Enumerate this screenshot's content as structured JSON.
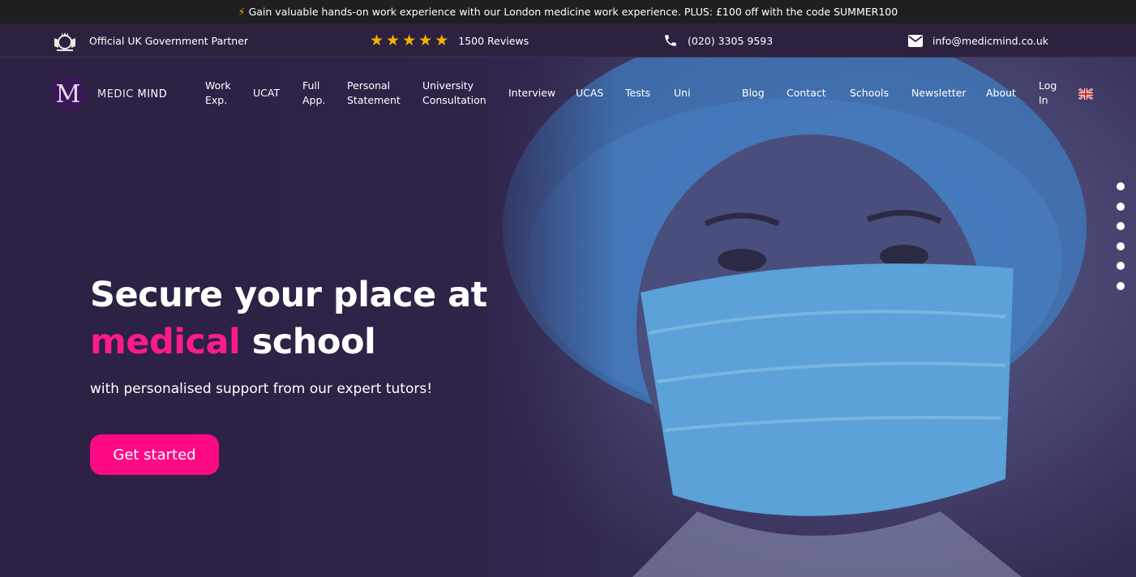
{
  "announcement": {
    "icon": "lightning-bolt-icon",
    "text": "Gain valuable hands-on work experience with our London medicine work experience. PLUS: £100 off with the code SUMMER100"
  },
  "infobar": {
    "gov_partner": "Official UK Government Partner",
    "reviews": "1500 Reviews",
    "stars": 5,
    "phone": "(020) 3305 9593",
    "email": "info@medicmind.co.uk"
  },
  "logo": {
    "mark": "M",
    "text_light": "MEDIC",
    "text_bold": "MIND"
  },
  "nav": {
    "items": [
      {
        "line1": "Work",
        "line2": "Exp."
      },
      {
        "line1": "UCAT",
        "line2": ""
      },
      {
        "line1": "Full",
        "line2": "App."
      },
      {
        "line1": "Personal",
        "line2": "Statement"
      },
      {
        "line1": "University",
        "line2": "Consultation"
      },
      {
        "line1": "Interview",
        "line2": ""
      },
      {
        "line1": "UCAS",
        "line2": ""
      },
      {
        "line1": "Tests",
        "line2": ""
      },
      {
        "line1": "Uni",
        "line2": ""
      },
      {
        "line1": "Blog",
        "line2": ""
      },
      {
        "line1": "Contact",
        "line2": ""
      },
      {
        "line1": "Schools",
        "line2": ""
      },
      {
        "line1": "Newsletter",
        "line2": ""
      },
      {
        "line1": "About",
        "line2": ""
      },
      {
        "line1": "Log",
        "line2": "In"
      }
    ],
    "language_icon": "uk-flag-icon"
  },
  "hero": {
    "headline_line1": "Secure your place at",
    "headline_highlight": "medical",
    "headline_rest": " school",
    "subline": "with personalised support from our expert tutors!",
    "cta_label": "Get started",
    "slide_count": 6
  },
  "colors": {
    "accent_pink": "#ff0a85",
    "star_yellow": "#f5b301",
    "hero_bg": "#2f2348"
  }
}
